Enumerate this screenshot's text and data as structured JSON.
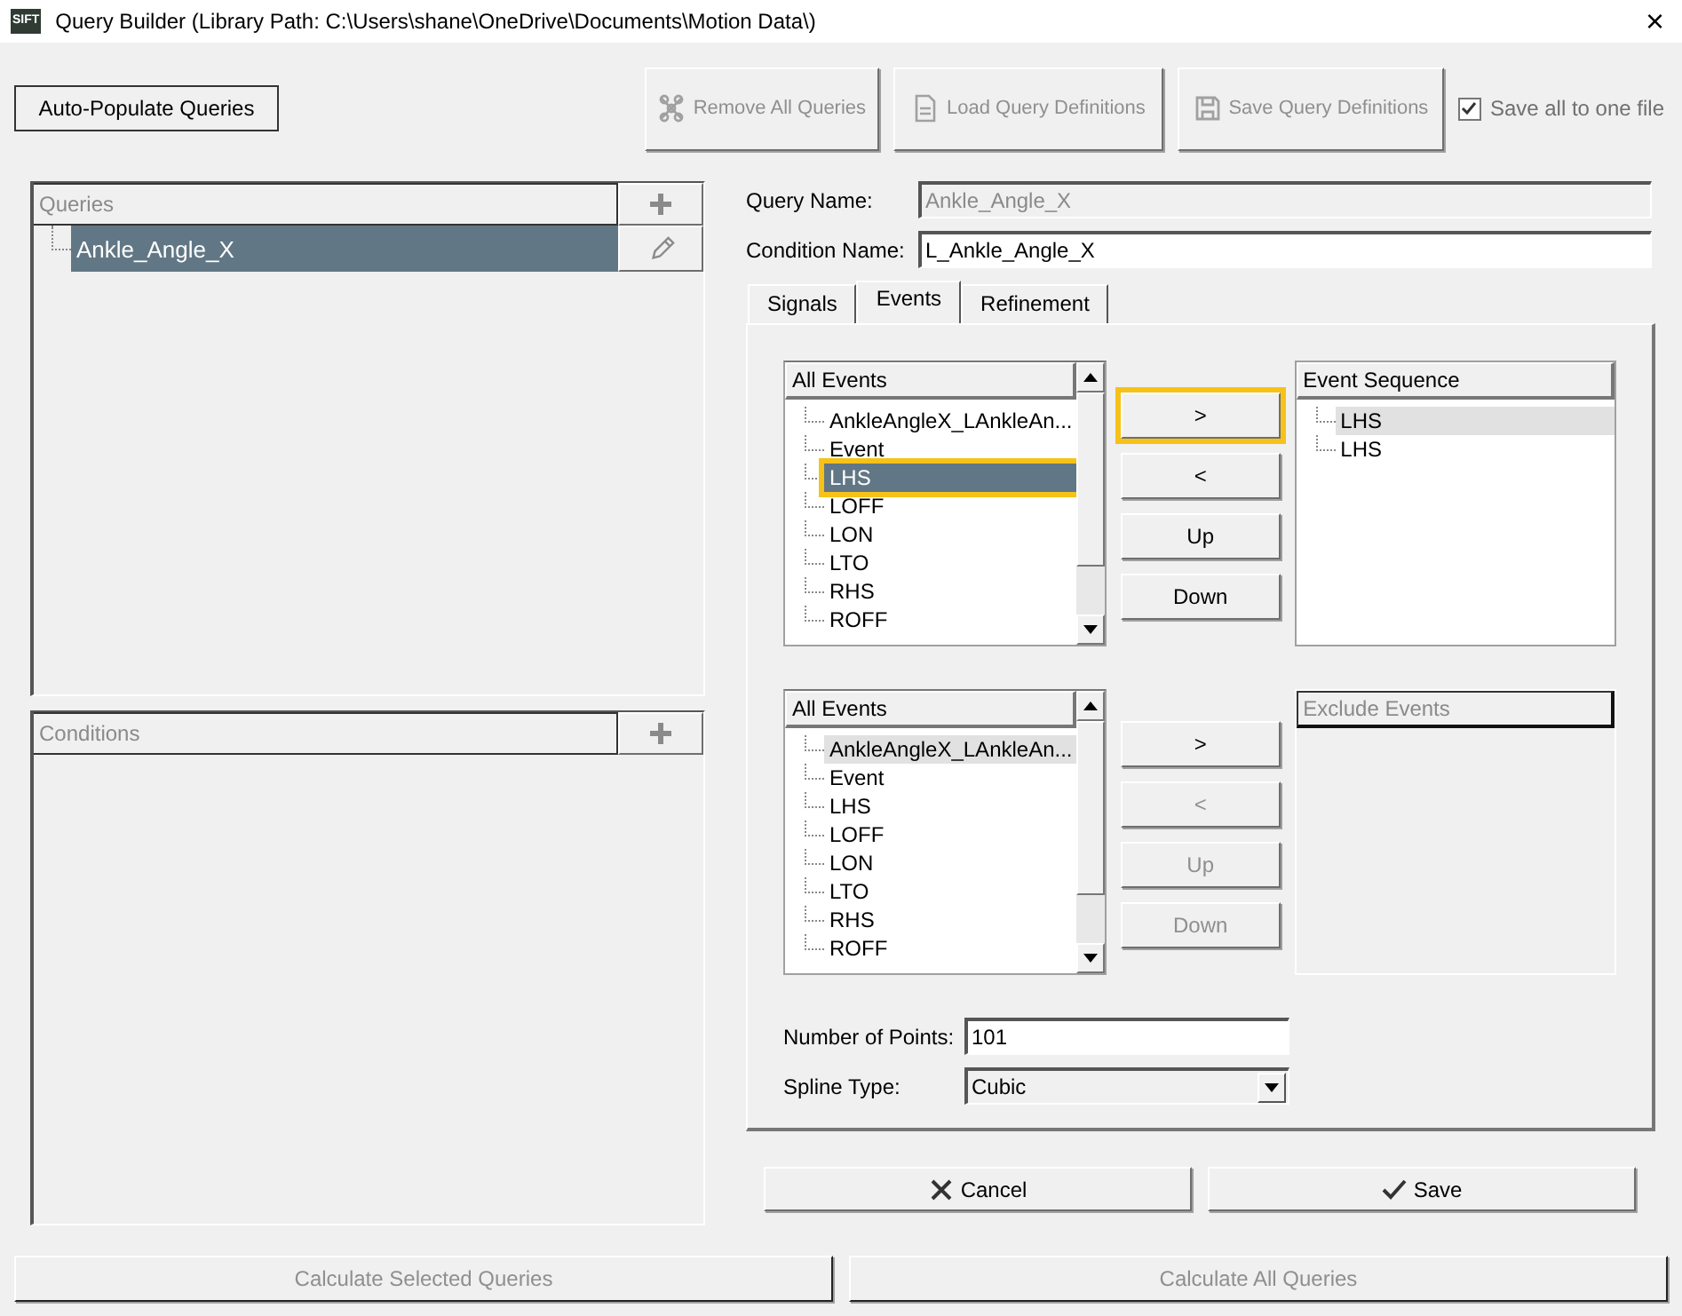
{
  "window": {
    "app_icon": "SIFT",
    "title": "Query Builder (Library Path: C:\\Users\\shane\\OneDrive\\Documents\\Motion Data\\)",
    "close": "×"
  },
  "toolbar": {
    "auto_populate": {
      "label": "Auto-Populate Queries",
      "disabled": false
    },
    "buttons": [
      {
        "label": "Remove All Queries",
        "disabled": true
      },
      {
        "label": "Load Query Definitions",
        "disabled": true
      },
      {
        "label": "Save Query Definitions",
        "disabled": true
      }
    ],
    "save_all": {
      "label": "Save all to one file",
      "checked": true
    }
  },
  "queries": {
    "header": "Queries",
    "items": [
      {
        "label": "Ankle_Angle_X",
        "selected": true
      }
    ]
  },
  "conditions": {
    "header": "Conditions"
  },
  "query_name": {
    "label": "Query Name:",
    "value": "Ankle_Angle_X",
    "disabled": true
  },
  "condition_name": {
    "label": "Condition Name:",
    "value": "L_Ankle_Angle_X",
    "disabled": false
  },
  "tabs": [
    {
      "label": "Signals",
      "selected": false
    },
    {
      "label": "Events",
      "selected": true
    },
    {
      "label": "Refinement",
      "selected": false
    }
  ],
  "event_groups": [
    {
      "source": {
        "header": "All Events",
        "items": [
          {
            "label": "AnkleAngleX_LAnkleAn...",
            "selected": false,
            "focused": false,
            "highlighted": false
          },
          {
            "label": "Event",
            "selected": false,
            "focused": false,
            "highlighted": false
          },
          {
            "label": "LHS",
            "selected": true,
            "focused": false,
            "highlighted": true
          },
          {
            "label": "LOFF",
            "selected": false,
            "focused": false,
            "highlighted": false
          },
          {
            "label": "LON",
            "selected": false,
            "focused": false,
            "highlighted": false
          },
          {
            "label": "LTO",
            "selected": false,
            "focused": false,
            "highlighted": false
          },
          {
            "label": "RHS",
            "selected": false,
            "focused": false,
            "highlighted": false
          },
          {
            "label": "ROFF",
            "selected": false,
            "focused": false,
            "highlighted": false
          }
        ]
      },
      "buttons": [
        {
          "label": ">",
          "disabled": false,
          "highlighted": true
        },
        {
          "label": "<",
          "disabled": false,
          "highlighted": false
        },
        {
          "label": "Up",
          "disabled": false,
          "highlighted": false
        },
        {
          "label": "Down",
          "disabled": false,
          "highlighted": false
        }
      ],
      "target": {
        "header": "Event Sequence",
        "disabled": false,
        "items": [
          {
            "label": "LHS",
            "focused": true
          },
          {
            "label": "LHS",
            "focused": false
          }
        ]
      }
    },
    {
      "source": {
        "header": "All Events",
        "items": [
          {
            "label": "AnkleAngleX_LAnkleAn...",
            "selected": false,
            "focused": true,
            "highlighted": false
          },
          {
            "label": "Event",
            "selected": false,
            "focused": false,
            "highlighted": false
          },
          {
            "label": "LHS",
            "selected": false,
            "focused": false,
            "highlighted": false
          },
          {
            "label": "LOFF",
            "selected": false,
            "focused": false,
            "highlighted": false
          },
          {
            "label": "LON",
            "selected": false,
            "focused": false,
            "highlighted": false
          },
          {
            "label": "LTO",
            "selected": false,
            "focused": false,
            "highlighted": false
          },
          {
            "label": "RHS",
            "selected": false,
            "focused": false,
            "highlighted": false
          },
          {
            "label": "ROFF",
            "selected": false,
            "focused": false,
            "highlighted": false
          }
        ]
      },
      "buttons": [
        {
          "label": ">",
          "disabled": false,
          "highlighted": false
        },
        {
          "label": "<",
          "disabled": true,
          "highlighted": false
        },
        {
          "label": "Up",
          "disabled": true,
          "highlighted": false
        },
        {
          "label": "Down",
          "disabled": true,
          "highlighted": false
        }
      ],
      "target": {
        "header": "Exclude Events",
        "disabled": true
      }
    }
  ],
  "number_of_points": {
    "label": "Number of Points:",
    "value": "101"
  },
  "spline_type": {
    "label": "Spline Type:",
    "value": "Cubic"
  },
  "actions": [
    {
      "label": "Cancel"
    },
    {
      "label": "Save"
    }
  ],
  "bottom_buttons": [
    {
      "label": "Calculate Selected Queries",
      "disabled": true
    },
    {
      "label": "Calculate All Queries",
      "disabled": true
    }
  ]
}
